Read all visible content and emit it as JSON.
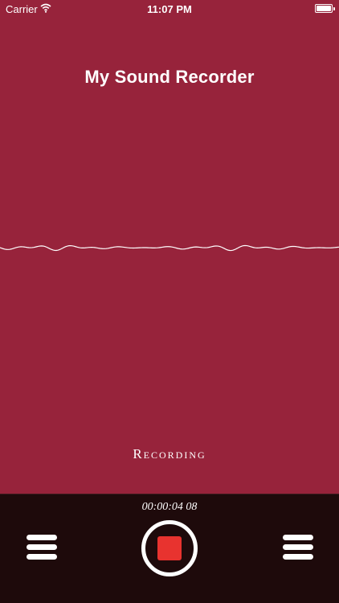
{
  "status_bar": {
    "carrier": "Carrier",
    "time": "11:07 PM"
  },
  "app": {
    "title": "My Sound Recorder",
    "status": "Recording"
  },
  "controls": {
    "elapsed": "00:00:04 08"
  },
  "colors": {
    "background": "#97233b",
    "bar": "#1e0a0b",
    "stop": "#e8332f",
    "text": "#ffffff"
  },
  "icons": {
    "left": "menu-icon",
    "center": "stop-icon",
    "right": "menu-icon",
    "wifi": "wifi-icon",
    "battery": "battery-icon"
  }
}
